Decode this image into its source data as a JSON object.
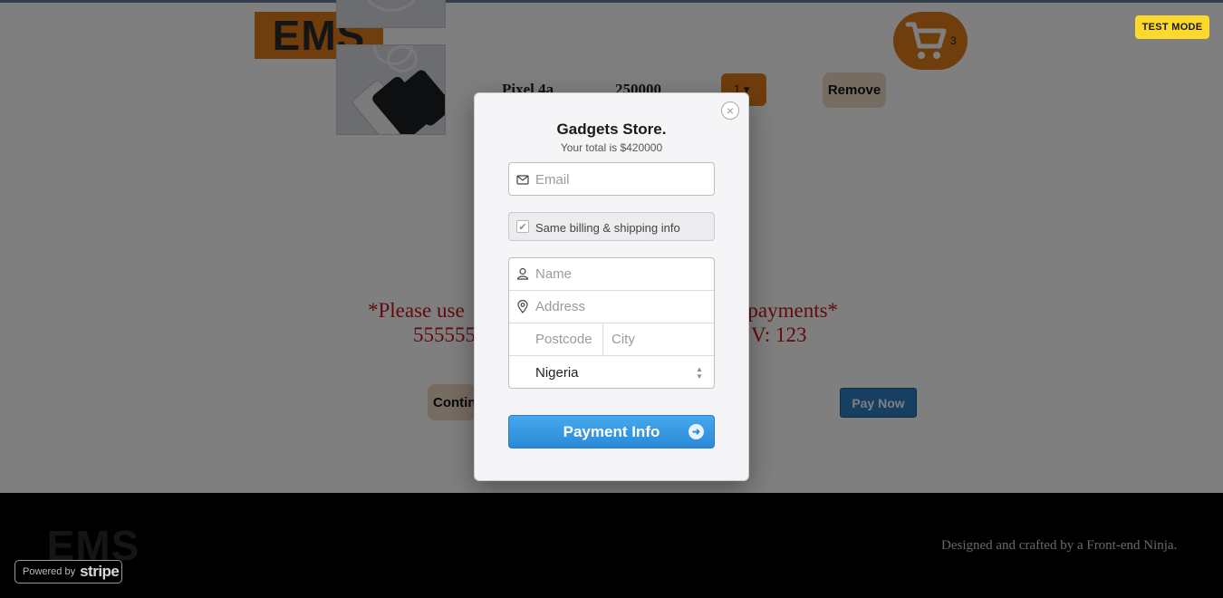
{
  "header": {
    "logo_text": "EMS",
    "cart_count": "3",
    "test_mode_label": "TEST MODE"
  },
  "cart_item": {
    "name": "Pixel 4a",
    "price": "250000",
    "quantity": "1",
    "remove_label": "Remove"
  },
  "notice": {
    "line1_start": "*Please use",
    "line1_end": "r payments*",
    "line2_start": "555555",
    "line2_end": "V: 123"
  },
  "actions": {
    "continue_label": "Continue",
    "pay_now_label": "Pay Now"
  },
  "footer": {
    "logo_text": "EMS",
    "credit": "Designed and crafted by a Front-end Ninja.",
    "powered_by": "Powered by",
    "powered_brand": "stripe"
  },
  "checkout": {
    "close_glyph": "×",
    "store_name": "Gadgets Store.",
    "total_text": "Your total is $420000",
    "email_placeholder": "Email",
    "same_info_label": "Same billing & shipping info",
    "name_placeholder": "Name",
    "address_placeholder": "Address",
    "postcode_placeholder": "Postcode",
    "city_placeholder": "City",
    "country_value": "Nigeria",
    "submit_label": "Payment Info",
    "icons": [
      "envelope-icon",
      "checkbox-icon",
      "user-icon",
      "location-pin-icon",
      "select-arrows-icon",
      "arrow-right-icon",
      "close-icon",
      "cart-icon"
    ]
  },
  "colors": {
    "brand_orange": "#e07b1a",
    "notice_red": "#c4151c",
    "stripe_blue": "#2b8ad8",
    "test_mode_yellow": "#fcd92a"
  }
}
